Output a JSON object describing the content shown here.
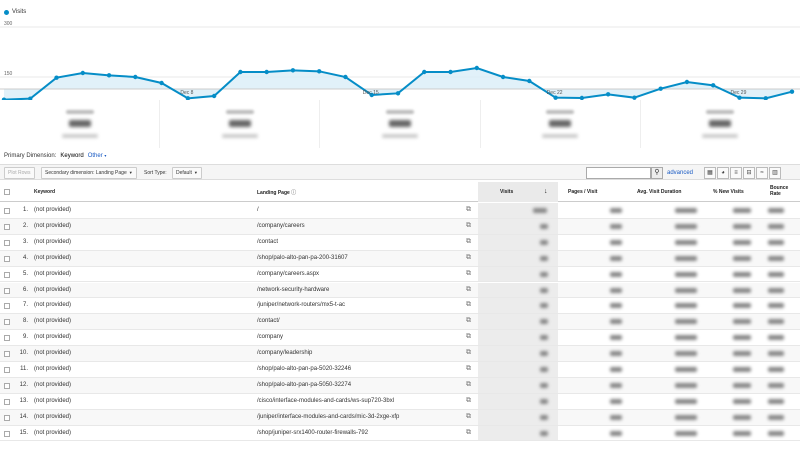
{
  "chart": {
    "legend_label": "Visits",
    "series_color": "#058dc7",
    "fill_color": "#d9edf7",
    "y_ticks": [
      "300",
      "150"
    ],
    "x_labels": [
      "Dec 8",
      "Dec 15",
      "Dec 22",
      "Dec 29"
    ],
    "value_axis_max": 300,
    "values": [
      82,
      85,
      148,
      162,
      155,
      150,
      132,
      86,
      93,
      165,
      165,
      170,
      167,
      150,
      96,
      101,
      165,
      165,
      177,
      150,
      138,
      88,
      87,
      98,
      88,
      115,
      135,
      125,
      88,
      86,
      106
    ]
  },
  "primary_dimension": {
    "label": "Primary Dimension:",
    "value": "Keyword",
    "other": "Other"
  },
  "toolbar": {
    "plot_rows": "Plot Rows",
    "secondary_dimension": "Secondary dimension: Landing Page",
    "sort_type_label": "Sort Type:",
    "sort_type_value": "Default",
    "advanced": "advanced"
  },
  "table": {
    "headers": {
      "keyword": "Keyword",
      "landing_page": "Landing Page",
      "visits": "Visits",
      "pages_visit": "Pages / Visit",
      "avg_duration": "Avg. Visit Duration",
      "new_visits": "% New Visits",
      "bounce_rate_1": "Bounce",
      "bounce_rate_2": "Rate"
    },
    "rows": [
      {
        "num": "1.",
        "keyword": "(not provided)",
        "landing_page": "/"
      },
      {
        "num": "2.",
        "keyword": "(not provided)",
        "landing_page": "/company/careers"
      },
      {
        "num": "3.",
        "keyword": "(not provided)",
        "landing_page": "/contact"
      },
      {
        "num": "4.",
        "keyword": "(not provided)",
        "landing_page": "/shop/palo-alto-pan-pa-200-31607"
      },
      {
        "num": "5.",
        "keyword": "(not provided)",
        "landing_page": "/company/careers.aspx"
      },
      {
        "num": "6.",
        "keyword": "(not provided)",
        "landing_page": "/network-security-hardware"
      },
      {
        "num": "7.",
        "keyword": "(not provided)",
        "landing_page": "/juniper/network-routers/mx5-t-ac"
      },
      {
        "num": "8.",
        "keyword": "(not provided)",
        "landing_page": "/contact/"
      },
      {
        "num": "9.",
        "keyword": "(not provided)",
        "landing_page": "/company"
      },
      {
        "num": "10.",
        "keyword": "(not provided)",
        "landing_page": "/company/leadership"
      },
      {
        "num": "11.",
        "keyword": "(not provided)",
        "landing_page": "/shop/palo-alto-pan-pa-5020-32246"
      },
      {
        "num": "12.",
        "keyword": "(not provided)",
        "landing_page": "/shop/palo-alto-pan-pa-5050-32274"
      },
      {
        "num": "13.",
        "keyword": "(not provided)",
        "landing_page": "/cisco/interface-modules-and-cards/ws-sup720-3bxl"
      },
      {
        "num": "14.",
        "keyword": "(not provided)",
        "landing_page": "/juniper/interface-modules-and-cards/mic-3d-2xge-xfp"
      },
      {
        "num": "15.",
        "keyword": "(not provided)",
        "landing_page": "/shop/juniper-srx1400-router-firewalls-792"
      }
    ]
  }
}
